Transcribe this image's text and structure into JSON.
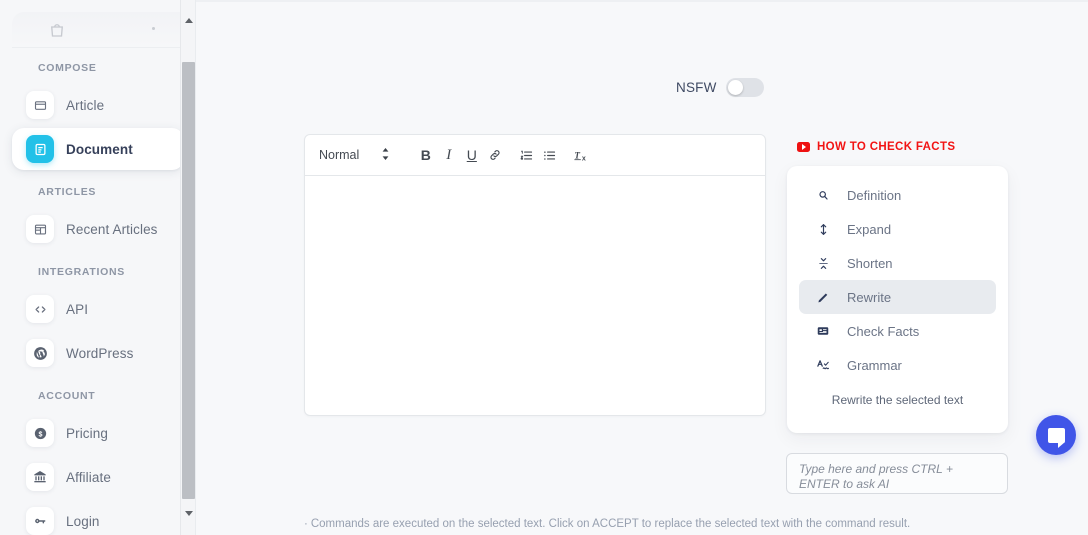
{
  "app": {
    "background_color": "#f7f8fa",
    "accent_color": "#22c1e8",
    "brand_logo_icon": "bag-logo-icon"
  },
  "sidebar": {
    "sections": [
      {
        "label": "COMPOSE",
        "items": [
          {
            "label": "Article",
            "icon": "window-icon",
            "active": false
          },
          {
            "label": "Document",
            "icon": "document-lines-icon",
            "active": true
          }
        ]
      },
      {
        "label": "ARTICLES",
        "items": [
          {
            "label": "Recent Articles",
            "icon": "layout-grid-icon",
            "active": false
          }
        ]
      },
      {
        "label": "INTEGRATIONS",
        "items": [
          {
            "label": "API",
            "icon": "code-brackets-icon",
            "active": false
          },
          {
            "label": "WordPress",
            "icon": "wordpress-icon",
            "active": false
          }
        ]
      },
      {
        "label": "ACCOUNT",
        "items": [
          {
            "label": "Pricing",
            "icon": "dollar-coin-icon",
            "active": false
          },
          {
            "label": "Affiliate",
            "icon": "bank-icon",
            "active": false
          },
          {
            "label": "Login",
            "icon": "key-icon",
            "active": false
          }
        ]
      }
    ],
    "scrollbar": {
      "up_arrow": "scroll-up-arrow",
      "down_arrow": "scroll-down-arrow"
    }
  },
  "nsfw": {
    "label": "NSFW",
    "state": "off"
  },
  "editor": {
    "toolbar": {
      "block_format": "Normal",
      "block_format_caret": "updown-caret-icon",
      "buttons": [
        {
          "name": "bold",
          "glyph": "B"
        },
        {
          "name": "italic",
          "glyph": "I"
        },
        {
          "name": "underline",
          "glyph": "U"
        },
        {
          "name": "link",
          "glyph": "link-icon"
        },
        {
          "name": "ordered-list",
          "glyph": "ordered-list-icon"
        },
        {
          "name": "bullet-list",
          "glyph": "bullet-list-icon"
        },
        {
          "name": "clear-format",
          "glyph": "Tx"
        }
      ]
    },
    "content": ""
  },
  "right_panel": {
    "howto": {
      "icon": "youtube-play-icon",
      "text": "HOW TO CHECK FACTS",
      "color": "#f21414"
    },
    "commands": [
      {
        "label": "Definition",
        "icon": "magnifier-icon",
        "selected": false
      },
      {
        "label": "Expand",
        "icon": "expand-arrows-icon",
        "selected": false
      },
      {
        "label": "Shorten",
        "icon": "shorten-arrows-icon",
        "selected": false
      },
      {
        "label": "Rewrite",
        "icon": "pencil-icon",
        "selected": true
      },
      {
        "label": "Check Facts",
        "icon": "fact-card-icon",
        "selected": false
      },
      {
        "label": "Grammar",
        "icon": "grammar-check-icon",
        "selected": false
      }
    ],
    "command_hint": "Rewrite the selected text",
    "ask_ai": {
      "value": "",
      "placeholder": "Type here and press CTRL + ENTER to ask AI"
    }
  },
  "footer": {
    "bullet": "·",
    "note": "Commands are executed on the selected text. Click on ACCEPT to replace the selected text with the command result."
  },
  "chat_widget": {
    "icon": "chat-bubble-icon",
    "color": "#4055e8"
  }
}
